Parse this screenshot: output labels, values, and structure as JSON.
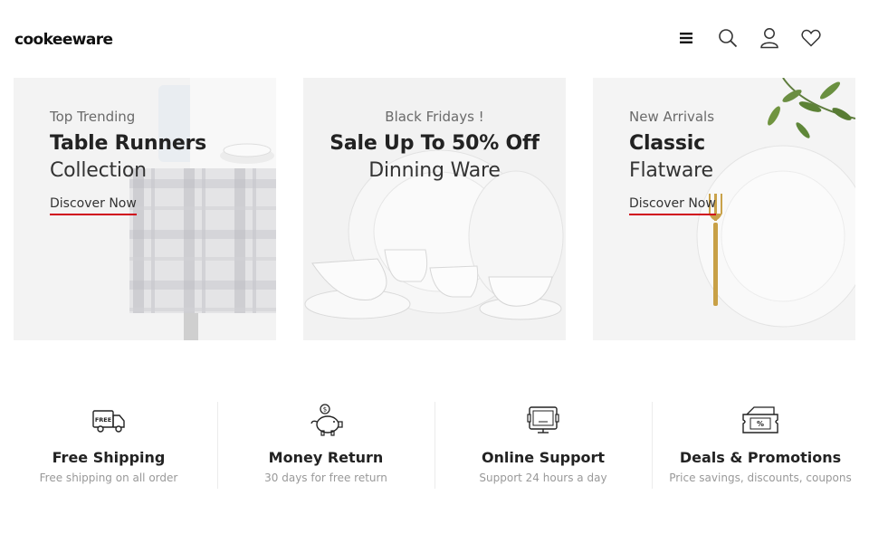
{
  "header": {
    "logo": "cookeeware",
    "icons": [
      "menu-icon",
      "search-icon",
      "user-icon",
      "heart-icon"
    ]
  },
  "banners": [
    {
      "kicker": "Top Trending",
      "title_bold": "Table Runners",
      "title_light": "Collection",
      "link": "Discover Now"
    },
    {
      "kicker": "Black Fridays !",
      "title_bold": "Sale Up To 50% Off",
      "title_light": "Dinning Ware",
      "link": ""
    },
    {
      "kicker": "New Arrivals",
      "title_bold": "Classic",
      "title_light": "Flatware",
      "link": "Discover Now"
    }
  ],
  "features": [
    {
      "icon": "delivery-truck-icon",
      "title": "Free Shipping",
      "subtitle": "Free shipping on all order"
    },
    {
      "icon": "piggy-bank-icon",
      "title": "Money Return",
      "subtitle": "30 days for free return"
    },
    {
      "icon": "support-icon",
      "title": "Online Support",
      "subtitle": "Support 24 hours a day"
    },
    {
      "icon": "discount-ticket-icon",
      "title": "Deals & Promotions",
      "subtitle": "Price savings, discounts, coupons"
    }
  ],
  "colors": {
    "accent": "#d0021b",
    "text": "#222222",
    "muted": "#999999"
  }
}
